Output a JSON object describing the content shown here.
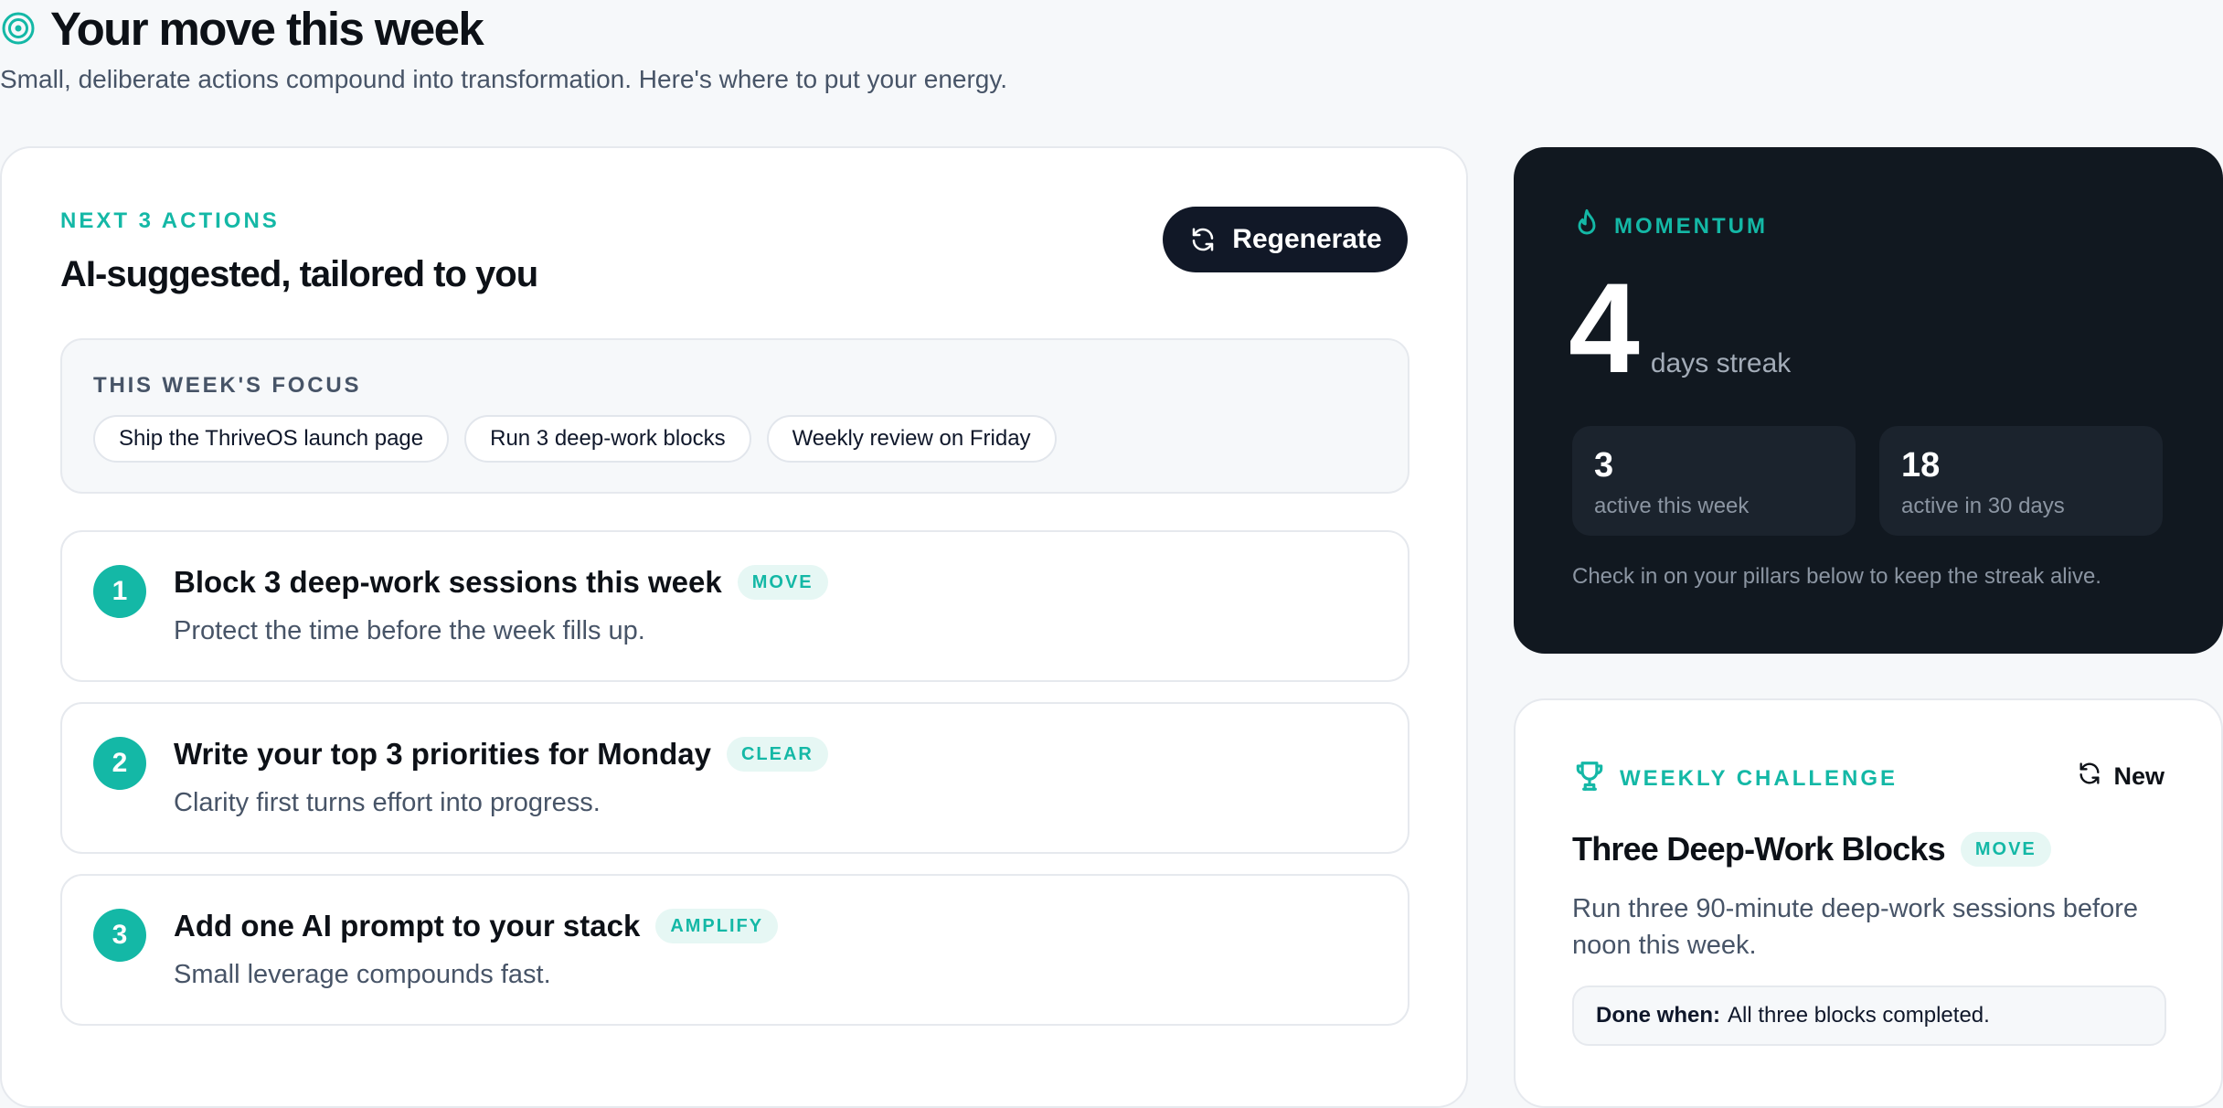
{
  "header": {
    "title": "Your move this week",
    "subtitle": "Small, deliberate actions compound into transformation. Here's where to put your energy.",
    "icon": "target-icon"
  },
  "actions": {
    "eyebrow": "NEXT 3 ACTIONS",
    "heading": "AI-suggested, tailored to you",
    "regenerate_label": "Regenerate",
    "focus": {
      "label": "THIS WEEK'S FOCUS",
      "chips": [
        "Ship the ThriveOS launch page",
        "Run 3 deep-work blocks",
        "Weekly review on Friday"
      ]
    },
    "items": [
      {
        "number": "1",
        "title": "Block 3 deep-work sessions this week",
        "tag": "MOVE",
        "desc": "Protect the time before the week fills up."
      },
      {
        "number": "2",
        "title": "Write your top 3 priorities for Monday",
        "tag": "CLEAR",
        "desc": "Clarity first turns effort into progress."
      },
      {
        "number": "3",
        "title": "Add one AI prompt to your stack",
        "tag": "AMPLIFY",
        "desc": "Small leverage compounds fast."
      }
    ]
  },
  "momentum": {
    "eyebrow": "MOMENTUM",
    "streak": "4",
    "streak_label": "days streak",
    "stats": [
      {
        "value": "3",
        "label": "active this week"
      },
      {
        "value": "18",
        "label": "active in 30 days"
      }
    ],
    "note": "Check in on your pillars below to keep the streak alive."
  },
  "challenge": {
    "eyebrow": "WEEKLY CHALLENGE",
    "new_label": "New",
    "title": "Three Deep-Work Blocks",
    "tag": "MOVE",
    "desc": "Run three 90-minute deep-work sessions before noon this week.",
    "done_label": "Done when:",
    "done_text": "All three blocks completed."
  },
  "colors": {
    "accent": "#14b8a6",
    "dark": "#111820",
    "text": "#0d1117",
    "muted": "#475467"
  }
}
